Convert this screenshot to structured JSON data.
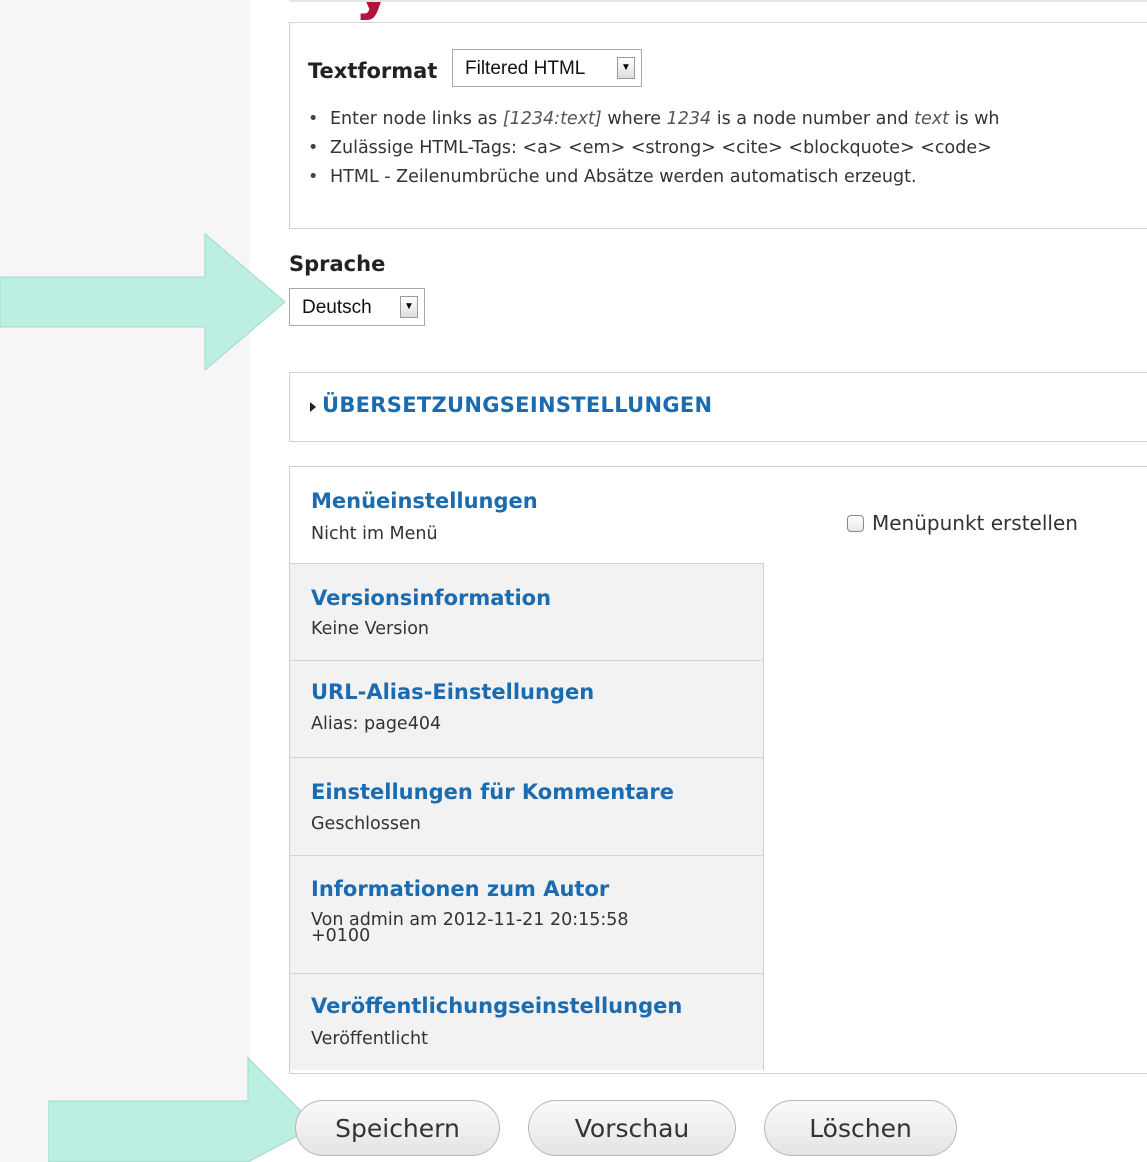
{
  "header": {
    "title_fragment": "y"
  },
  "text_format": {
    "label": "Textformat",
    "selected": "Filtered HTML",
    "tips": [
      {
        "pre": "Enter node links as ",
        "em1": "[1234:text]",
        "mid": " where ",
        "em2": "1234",
        "mid2": " is a node number and ",
        "em3": "text",
        "post": " is wh"
      },
      {
        "text": "Zulässige HTML-Tags: <a> <em> <strong> <cite> <blockquote> <code>"
      },
      {
        "text": "HTML - Zeilenumbrüche und Absätze werden automatisch erzeugt."
      }
    ]
  },
  "language": {
    "label": "Sprache",
    "selected": "Deutsch"
  },
  "translation": {
    "label": "ÜBERSETZUNGSEINSTELLUNGEN"
  },
  "vertical_tabs": [
    {
      "title": "Menüeinstellungen",
      "summary": "Nicht im Menü"
    },
    {
      "title": "Versionsinformation",
      "summary": "Keine Version"
    },
    {
      "title": "URL-Alias-Einstellungen",
      "summary": "Alias: page404"
    },
    {
      "title": "Einstellungen für Kommentare",
      "summary": "Geschlossen"
    },
    {
      "title": "Informationen zum Autor",
      "summary1": "Von admin am 2012-11-21 20:15:58",
      "summary2": "+0100"
    },
    {
      "title": "Veröffentlichungseinstellungen",
      "summary": "Veröffentlicht"
    }
  ],
  "menu_pane": {
    "checkbox_label": "Menüpunkt erstellen"
  },
  "actions": {
    "save": "Speichern",
    "preview": "Vorschau",
    "delete": "Löschen"
  },
  "colors": {
    "link": "#1a6bb0",
    "arrow": "#b9ece0",
    "title": "#b0153a"
  }
}
